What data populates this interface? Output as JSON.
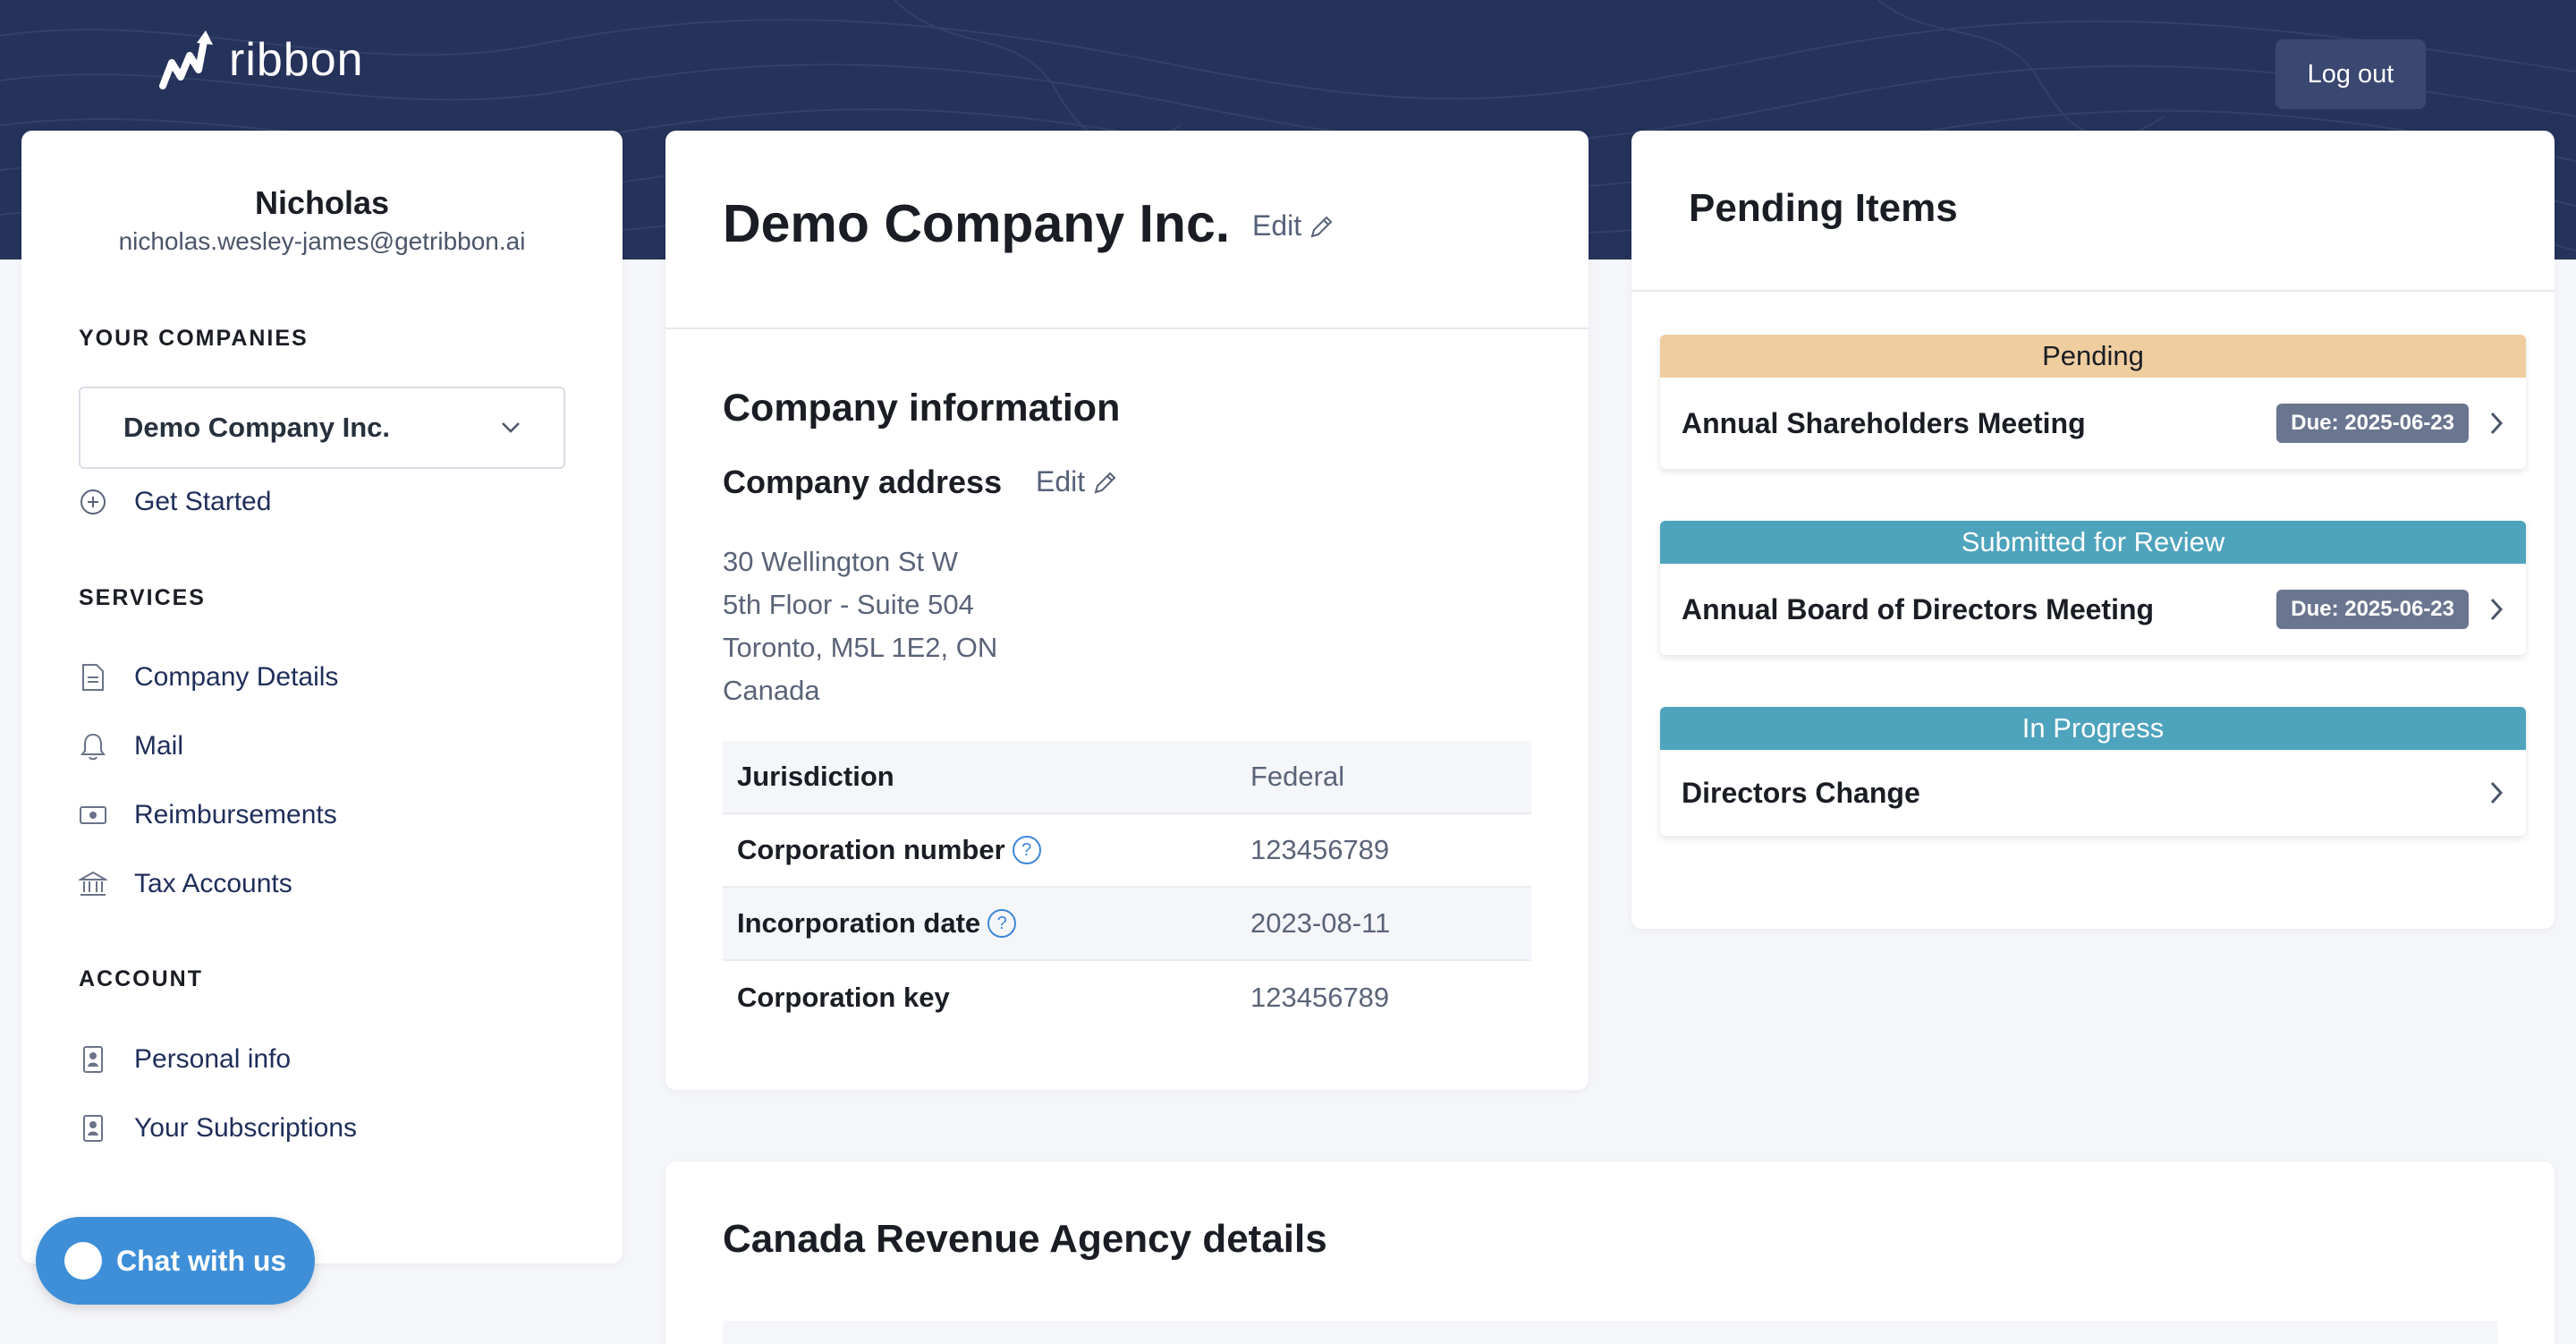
{
  "header": {
    "brand": "ribbon",
    "logout_label": "Log out"
  },
  "user": {
    "name": "Nicholas",
    "email": "nicholas.wesley-james@getribbon.ai"
  },
  "sidebar": {
    "companies_title": "YOUR COMPANIES",
    "selected_company": "Demo Company Inc.",
    "get_started": "Get Started",
    "services_title": "SERVICES",
    "services": [
      {
        "label": "Company Details",
        "icon": "document-icon"
      },
      {
        "label": "Mail",
        "icon": "bell-icon"
      },
      {
        "label": "Reimbursements",
        "icon": "cash-icon"
      },
      {
        "label": "Tax Accounts",
        "icon": "bank-icon"
      }
    ],
    "account_title": "ACCOUNT",
    "account": [
      {
        "label": "Personal info",
        "icon": "id-badge-icon"
      },
      {
        "label": "Your Subscriptions",
        "icon": "id-badge-icon"
      }
    ]
  },
  "chat": {
    "label": "Chat with us"
  },
  "company": {
    "name": "Demo Company Inc.",
    "edit_label": "Edit",
    "info_title": "Company information",
    "address_title": "Company address",
    "address_edit_label": "Edit",
    "address_lines": [
      "30 Wellington St W",
      "5th Floor - Suite 504",
      "Toronto, M5L 1E2, ON",
      "Canada"
    ],
    "rows": [
      {
        "label": "Jurisdiction",
        "value": "Federal"
      },
      {
        "label": "Corporation number",
        "value": "123456789"
      },
      {
        "label": "Incorporation date",
        "value": "2023-08-11"
      },
      {
        "label": "Corporation key",
        "value": "123456789"
      }
    ]
  },
  "pending": {
    "title": "Pending Items",
    "items": [
      {
        "status": "Pending",
        "name": "Annual Shareholders Meeting",
        "due": "Due: 2025-06-23",
        "status_color": "#efcd9f",
        "status_text_color": "#1a1d24"
      },
      {
        "status": "Submitted for Review",
        "name": "Annual Board of Directors Meeting",
        "due": "Due: 2025-06-23",
        "status_color": "#4ea3bd",
        "status_text_color": "#ffffff"
      },
      {
        "status": "In Progress",
        "name": "Directors Change",
        "status_color": "#4ea3bd",
        "status_text_color": "#ffffff"
      }
    ]
  },
  "cra": {
    "title": "Canada Revenue Agency details"
  },
  "colors": {
    "header_bg": "#25325a",
    "link": "#1f2e5a",
    "chat_bg": "#3e8fd8"
  }
}
